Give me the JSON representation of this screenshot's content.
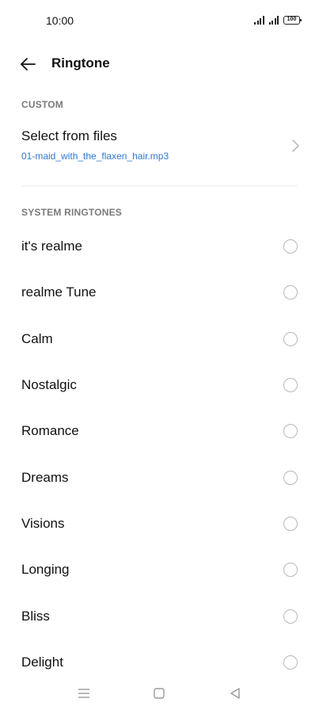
{
  "status_bar": {
    "time": "10:00",
    "battery": "100"
  },
  "header": {
    "title": "Ringtone",
    "back_icon": "arrow-left-icon"
  },
  "custom_section": {
    "header": "CUSTOM",
    "item": {
      "title": "Select from files",
      "subtitle": "01-maid_with_the_flaxen_hair.mp3",
      "icon": "chevron-right-icon"
    }
  },
  "system_section": {
    "header": "SYSTEM RINGTONES",
    "items": [
      {
        "label": "it's realme",
        "selected": false
      },
      {
        "label": "realme Tune",
        "selected": false
      },
      {
        "label": "Calm",
        "selected": false
      },
      {
        "label": "Nostalgic",
        "selected": false
      },
      {
        "label": "Romance",
        "selected": false
      },
      {
        "label": "Dreams",
        "selected": false
      },
      {
        "label": "Visions",
        "selected": false
      },
      {
        "label": "Longing",
        "selected": false
      },
      {
        "label": "Bliss",
        "selected": false
      },
      {
        "label": "Delight",
        "selected": false
      }
    ]
  },
  "colors": {
    "accent": "#2f78d6",
    "section_header": "#7a7a7a",
    "radio_border": "#b8b8b8"
  },
  "nav_bar": {
    "icons": [
      "menu-icon",
      "home-icon",
      "back-triangle-icon"
    ]
  }
}
